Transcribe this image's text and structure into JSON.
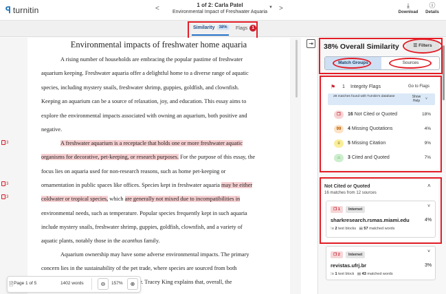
{
  "header": {
    "logo_text": "turnitin",
    "doc_counter": "1 of 2: Carla Patel",
    "doc_title": "Environmental Impact of Freshwater Aquaria",
    "download_label": "Download",
    "details_label": "Details",
    "download_icon": "download-icon",
    "details_icon": "info-icon"
  },
  "tabs": {
    "similarity_label": "Similarity",
    "similarity_pct": "38%",
    "flags_label": "Flags",
    "flags_count": "1"
  },
  "document": {
    "heading": "Environmental impacts of freshwater home aquaria",
    "lines": [
      "A rising number of households are embracing the popular pastime of freshwater",
      "aquarium keeping. Freshwater aquaria offer a delightful home to a diverse range of aquatic",
      "species, including mystery snails, freshwater shrimp, guppies, goldfish, and clownfish.",
      "Keeping an aquarium can be a source of relaxation, joy, and education. This essay aims to",
      "explore the environmental impacts associated with owning an aquarium, both positive and",
      "negative."
    ],
    "p2_line1": "A freshwater aquarium is a receptacle that holds one or more freshwater aquatic",
    "p2_line2_hl": "organisms for decorative, pet-keeping, or research purposes.",
    "p2_line2_rest": " For the purpose of this essay, the",
    "p2_line3": "focus lies on aquaria used for non-research reasons, such as home pet-keeping or",
    "p2_line4_a": "ornamentation in public spaces like offices. Species kept in freshwater aquaria ",
    "p2_line4_hl": "may be either",
    "p2_line5_hl1": "coldwater or tropical species,",
    "p2_line5_mid": " which ",
    "p2_line5_hl2": "are generally not mixed due to incompatibilities in",
    "p2_line6": "environmental needs, such as temperature. Popular species frequently kept in such aquaria",
    "p2_line7": "include mystery snails, freshwater shrimp, guppies, goldfish, clownfish, and a variety of",
    "p2_line8_a": "aquatic plants, notably those in the ",
    "p2_line8_i": "acanthus",
    "p2_line8_b": " family.",
    "p3_line1": "Aquarium ownership may have some adverse environmental impacts. The primary",
    "p3_line2": "concern lies in the sustainability of the pet trade, where species are sourced from both",
    "p3_line3": "r. Tracey King explains that, overall, the",
    "match_tags": [
      "3",
      "3",
      "3"
    ]
  },
  "footer": {
    "page_label": "Page 1 of 5",
    "word_count": "1402 words",
    "zoom_level": "157%",
    "zoom_out": "−",
    "zoom_in": "+"
  },
  "panel": {
    "overall_title": "38% Overall Similarity",
    "filters_label": "Filters",
    "mode_match_groups": "Match Groups",
    "mode_sources": "Sources",
    "integrity_count": "1",
    "integrity_label": "Integrity Flags",
    "go_to_flags": "Go to Flags",
    "info_text": "28 matches found with Turnitin's database",
    "show_help": "Show Help",
    "categories": [
      {
        "count": "16",
        "label": "Not Cited or Quoted",
        "pct": "18%",
        "icon": "quote-missing-icon",
        "color": "#f6d3d4",
        "fg": "#c8202f",
        "glyph": "❐"
      },
      {
        "count": "4",
        "label": "Missing Quotations",
        "pct": "4%",
        "icon": "quotation-icon",
        "color": "#fde2c4",
        "fg": "#b35a00",
        "glyph": "99"
      },
      {
        "count": "5",
        "label": "Missing Citation",
        "pct": "9%",
        "icon": "citation-icon",
        "color": "#faee9a",
        "fg": "#6b5a00",
        "glyph": "≡"
      },
      {
        "count": "3",
        "label": "Cited and Quoted",
        "pct": "7%",
        "icon": "graduation-icon",
        "color": "#cdeecd",
        "fg": "#2d7a2d",
        "glyph": "⌂"
      }
    ],
    "group_title": "Not Cited or Quoted",
    "group_sub": "16 matches from 12 sources",
    "sources": [
      {
        "badge": "1",
        "type": "Internet",
        "name": "sharkresearch.rsmas.miami.edu",
        "pct": "4%",
        "blocks": "2",
        "blocks_label": "text blocks",
        "words": "57",
        "words_label": "matched words"
      },
      {
        "badge": "2",
        "type": "Internet",
        "name": "revistas.ufrj.br",
        "pct": "3%",
        "blocks": "1",
        "blocks_label": "text block",
        "words": "43",
        "words_label": "matched words"
      }
    ]
  }
}
